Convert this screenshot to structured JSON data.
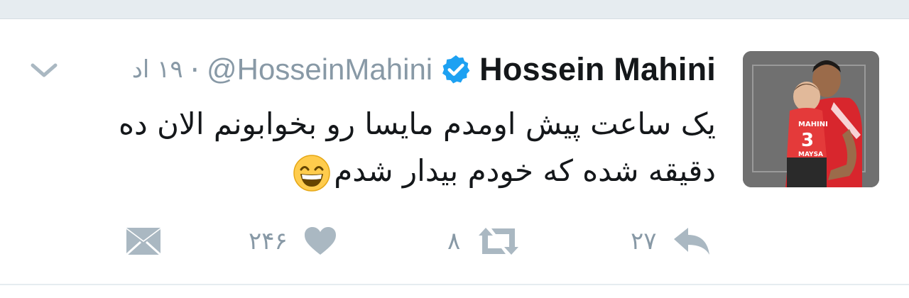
{
  "tweet": {
    "display_name": "Hossein Mahini",
    "handle": "@HosseinMahini",
    "separator": "·",
    "time": "۱۹ اد",
    "text": "یک ساعت پیش اومدم مایسا رو بخوابونم الان ده دقیقه شده که خودم بیدار شدم",
    "emoji": "grinning-face-with-smiling-eyes",
    "verified": true
  },
  "actions": {
    "reply_count": "۲۷",
    "retweet_count": "۸",
    "like_count": "۲۴۶"
  },
  "avatar": {
    "jersey_name": "MAHINI",
    "jersey_number": "3",
    "child_jersey_name": "MAYSA"
  },
  "colors": {
    "text": "#14171a",
    "secondary": "#8899a6",
    "verified": "#1da1f2",
    "icon": "#aab8c2"
  }
}
